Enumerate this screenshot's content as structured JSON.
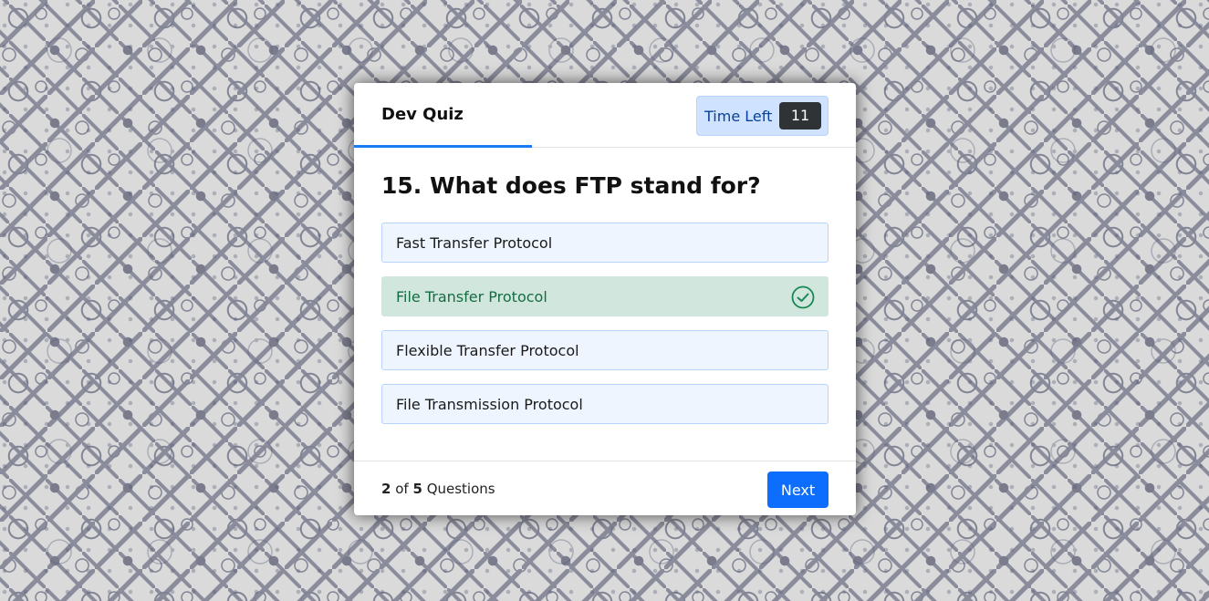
{
  "quiz": {
    "title": "Dev Quiz",
    "timer_label": "Time Left",
    "timer_value": "11"
  },
  "question": {
    "text": "15. What does FTP stand for?",
    "options": [
      {
        "label": "Fast Transfer Protocol",
        "state": "default"
      },
      {
        "label": "File Transfer Protocol",
        "state": "correct"
      },
      {
        "label": "Flexible Transfer Protocol",
        "state": "default"
      },
      {
        "label": "File Transmission Protocol",
        "state": "default"
      }
    ]
  },
  "footer": {
    "current": "2",
    "of_text": "of",
    "total": "5",
    "suffix": "Questions",
    "next_label": "Next"
  },
  "colors": {
    "accent": "#0d6efd",
    "correct_bg": "#d1e7dd",
    "correct_text": "#146c43",
    "timer_bg": "#cfe2ff"
  },
  "icons": {
    "correct": "check-circle-icon"
  }
}
